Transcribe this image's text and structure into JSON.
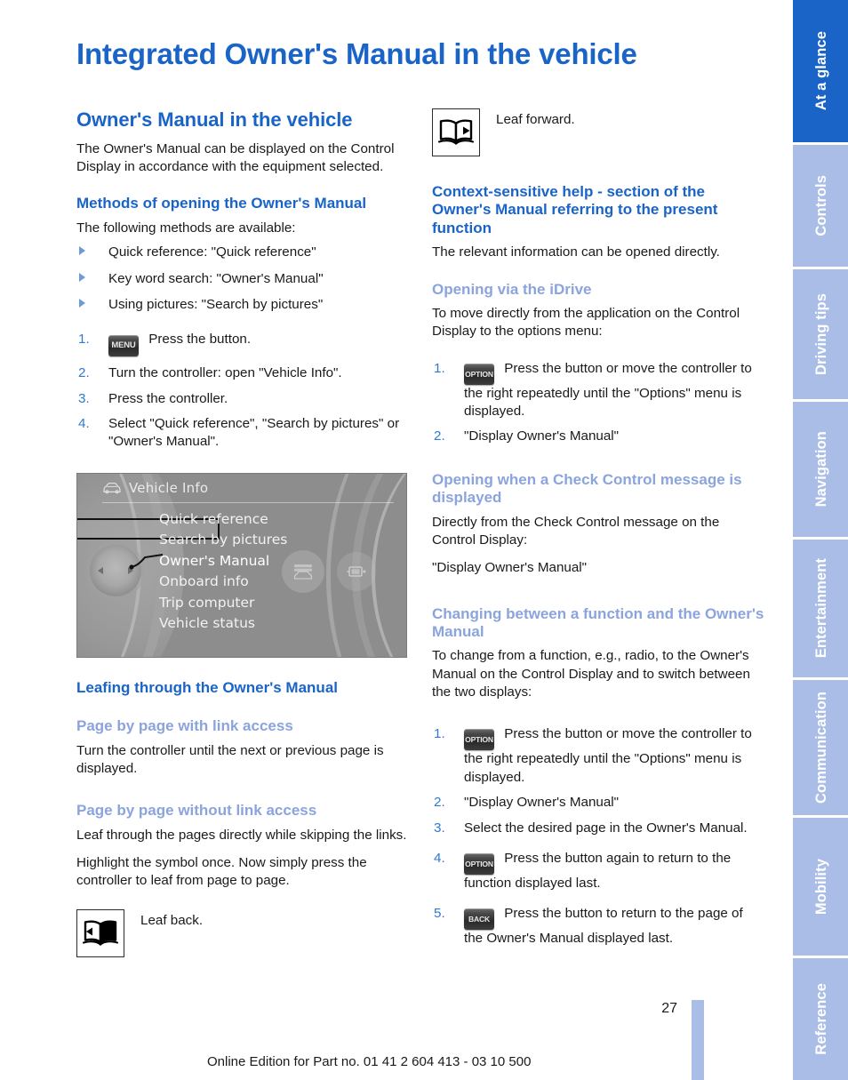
{
  "document": {
    "title": "Integrated Owner's Manual in the vehicle",
    "page_number": "27",
    "footer": "Online Edition for Part no. 01 41 2 604 413 - 03 10 500"
  },
  "colors": {
    "heading_blue": "#1a64c8",
    "subheading_light_blue": "#8ba4dd",
    "rail_inactive": "#a9bde6",
    "rail_active": "#1a64c8"
  },
  "rail": {
    "tabs": [
      {
        "label": "At a glance",
        "active": true
      },
      {
        "label": "Controls",
        "active": false
      },
      {
        "label": "Driving tips",
        "active": false
      },
      {
        "label": "Navigation",
        "active": false
      },
      {
        "label": "Entertainment",
        "active": false
      },
      {
        "label": "Communication",
        "active": false
      },
      {
        "label": "Mobility",
        "active": false
      },
      {
        "label": "Reference",
        "active": false
      }
    ]
  },
  "left_column": {
    "section_title": "Owner's Manual in the vehicle",
    "intro": "The Owner's Manual can be displayed on the Control Display in accordance with the equipment selected.",
    "methods_heading": "Methods of opening the Owner's Manual",
    "methods_intro": "The following methods are available:",
    "methods_bullets": [
      "Quick reference: \"Quick reference\"",
      "Key word search: \"Owner's Manual\"",
      "Using pictures: \"Search by pictures\""
    ],
    "steps": [
      {
        "num": "1.",
        "button": "MENU",
        "text": "Press the button."
      },
      {
        "num": "2.",
        "button": "",
        "text": "Turn the controller: open \"Vehicle Info\"."
      },
      {
        "num": "3.",
        "button": "",
        "text": "Press the controller."
      },
      {
        "num": "4.",
        "button": "",
        "text": "Select \"Quick reference\", \"Search by pictures\" or \"Owner's Manual\"."
      }
    ],
    "leafing_heading": "Leafing through the Owner's Manual",
    "with_link_heading": "Page by page with link access",
    "with_link_text": "Turn the controller until the next or previous page is displayed.",
    "without_link_heading": "Page by page without link access",
    "without_link_text_1": "Leaf through the pages directly while skipping the links.",
    "without_link_text_2": "Highlight the symbol once. Now simply press the controller to leaf from page to page.",
    "leaf_back_caption": "Leaf back."
  },
  "idrive_screen": {
    "header_title": "Vehicle Info",
    "header_icon": "car-icon",
    "items": [
      {
        "label": "Quick reference",
        "selected": false,
        "checked": false
      },
      {
        "label": "Search by pictures",
        "selected": false,
        "checked": false
      },
      {
        "label": "Owner's Manual",
        "selected": true,
        "checked": true
      },
      {
        "label": "Onboard info",
        "selected": false,
        "checked": false
      },
      {
        "label": "Trip computer",
        "selected": false,
        "checked": false
      },
      {
        "label": "Vehicle status",
        "selected": false,
        "checked": false
      }
    ],
    "check_glyph": "✓"
  },
  "right_column": {
    "leaf_forward_caption": "Leaf forward.",
    "context_heading": "Context-sensitive help - section of the Owner's Manual referring to the present function",
    "context_text": "The relevant information can be opened directly.",
    "idrive_heading": "Opening via the iDrive",
    "idrive_text": "To move directly from the application on the Control Display to the options menu:",
    "idrive_steps": [
      {
        "num": "1.",
        "button": "OPTION",
        "text": "Press the button or move the controller to the right repeatedly until the \"Options\" menu is displayed."
      },
      {
        "num": "2.",
        "button": "",
        "text": "\"Display Owner's Manual\""
      }
    ],
    "check_control_heading": "Opening when a Check Control message is displayed",
    "check_control_text": "Directly from the Check Control message on the Control Display:",
    "check_control_quote": "\"Display Owner's Manual\"",
    "changing_heading": "Changing between a function and the Owner's Manual",
    "changing_text": "To change from a function, e.g., radio, to the Owner's Manual on the Control Display and to switch between the two displays:",
    "changing_steps": [
      {
        "num": "1.",
        "button": "OPTION",
        "text": "Press the button or move the controller to the right repeatedly until the \"Options\" menu is displayed."
      },
      {
        "num": "2.",
        "button": "",
        "text": "\"Display Owner's Manual\""
      },
      {
        "num": "3.",
        "button": "",
        "text": "Select the desired page in the Owner's Manual."
      },
      {
        "num": "4.",
        "button": "OPTION",
        "text": "Press the button again to return to the function displayed last."
      },
      {
        "num": "5.",
        "button": "BACK",
        "text": "Press the button to return to the page of the Owner's Manual displayed last."
      }
    ]
  }
}
